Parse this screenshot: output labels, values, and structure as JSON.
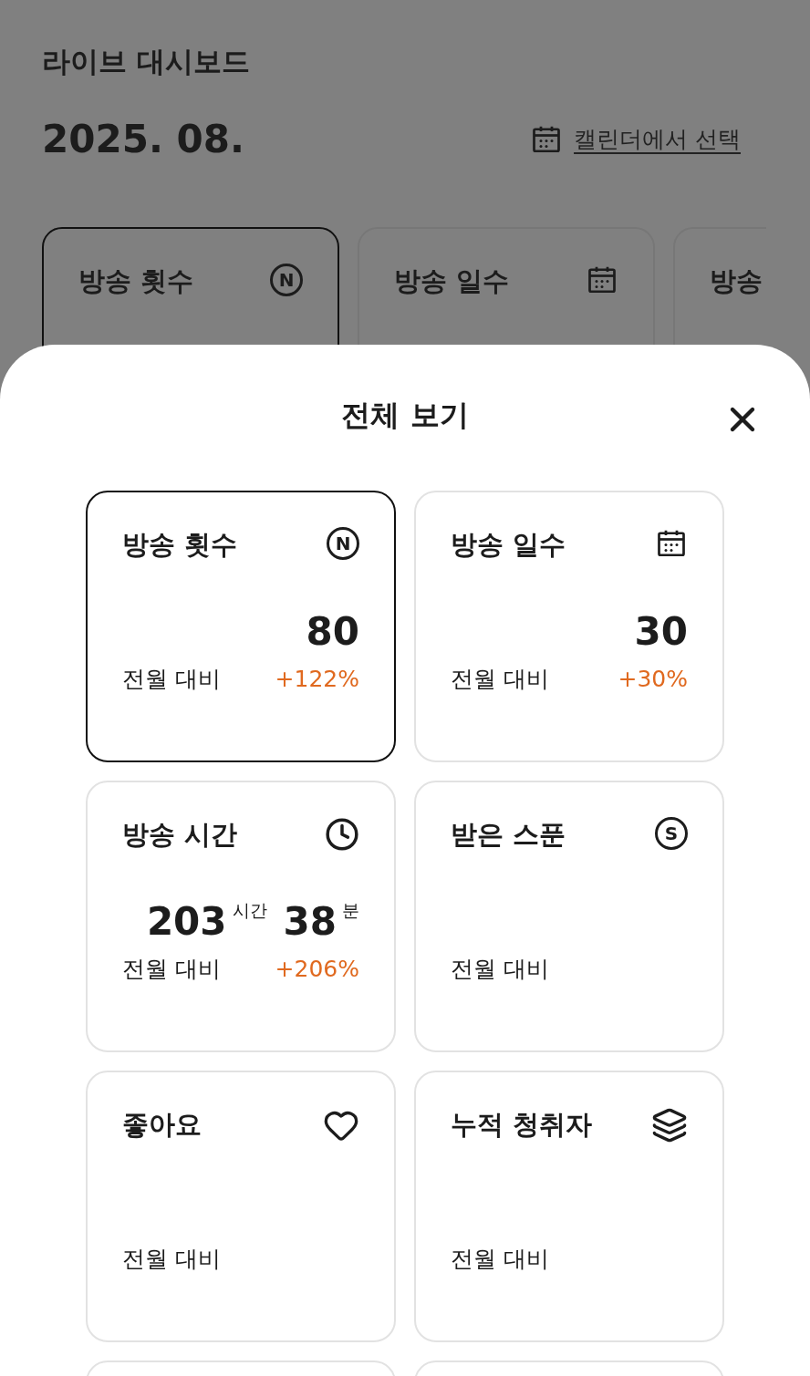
{
  "dashboard": {
    "title": "라이브 대시보드",
    "month": "2025. 08.",
    "calendar_link": "캘린더에서 선택",
    "cards": [
      {
        "label": "방송 횟수",
        "badge": "N",
        "selected": true
      },
      {
        "label": "방송 일수",
        "selected": false
      },
      {
        "label": "방송",
        "selected": false
      }
    ]
  },
  "sheet": {
    "title": "전체 보기",
    "cards": [
      {
        "label": "방송 횟수",
        "badge": "N",
        "selected": true,
        "kind": "count",
        "value": "80",
        "compare_label": "전월 대비",
        "change": "+122%"
      },
      {
        "label": "방송 일수",
        "selected": false,
        "kind": "count",
        "value": "30",
        "compare_label": "전월 대비",
        "change": "+30%"
      },
      {
        "label": "방송 시간",
        "selected": false,
        "kind": "duration",
        "hours": "203",
        "hours_unit": "시간",
        "minutes": "38",
        "minutes_unit": "분",
        "compare_label": "전월 대비",
        "change": "+206%"
      },
      {
        "label": "받은 스푼",
        "badge": "S",
        "selected": false,
        "kind": "empty",
        "compare_label": "전월 대비"
      },
      {
        "label": "좋아요",
        "selected": false,
        "kind": "empty",
        "compare_label": "전월 대비"
      },
      {
        "label": "누적 청취자",
        "selected": false,
        "kind": "empty",
        "compare_label": "전월 대비"
      },
      {
        "selected": false,
        "kind": "blank"
      },
      {
        "selected": false,
        "kind": "blank"
      }
    ]
  }
}
